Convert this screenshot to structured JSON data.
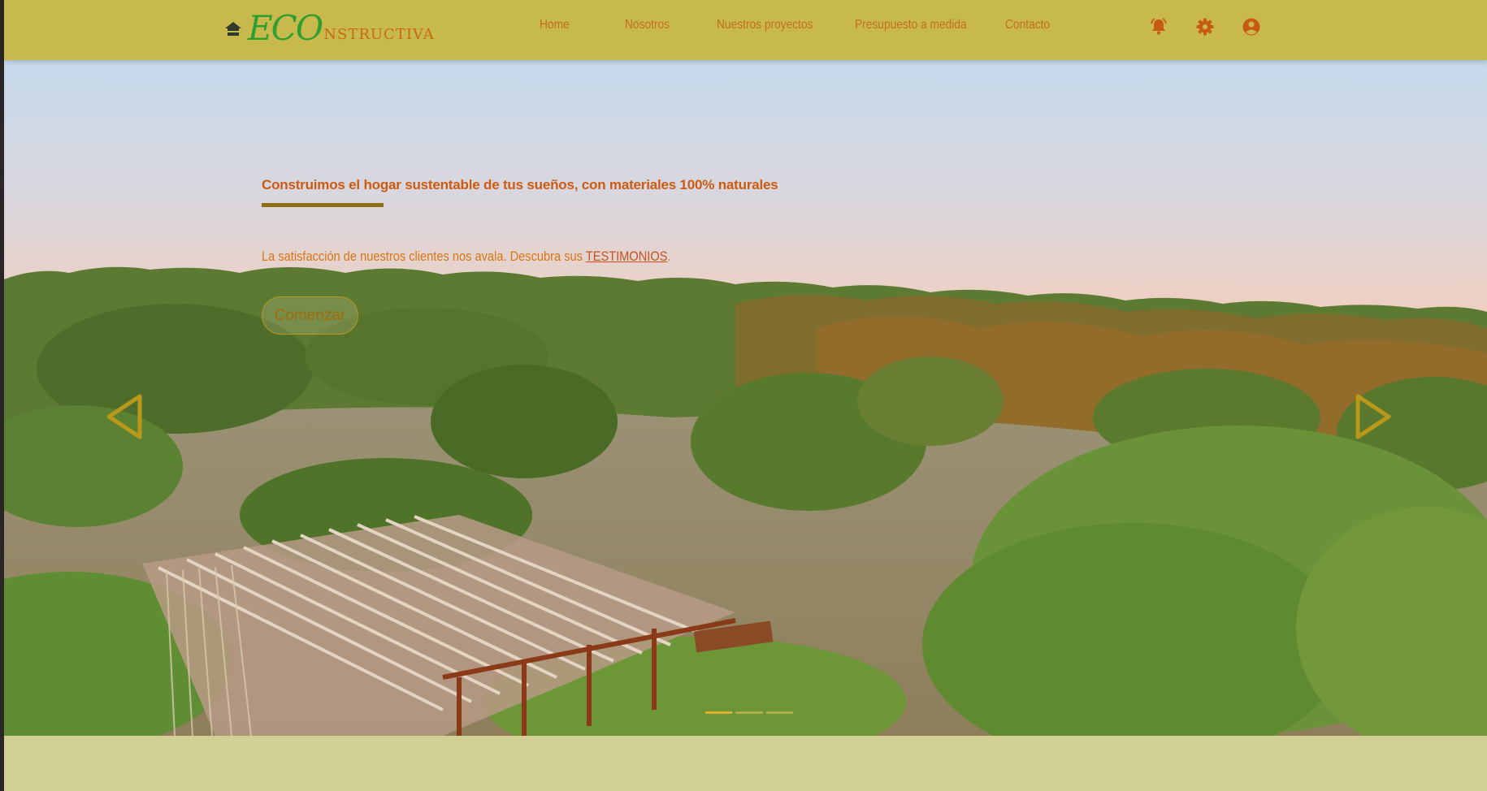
{
  "brand": {
    "prefix": "ECO",
    "suffix": "nstructiva",
    "home_icon": "home-icon",
    "colors": {
      "prefix": "#2e9e30",
      "suffix": "#c86a10"
    }
  },
  "nav": {
    "links": [
      "Home",
      "Nosotros",
      "Nuestros proyectos",
      "Presupuesto a medida",
      "Contacto"
    ],
    "icons": [
      "bell-icon",
      "gear-icon",
      "user-circle-icon"
    ],
    "color": "#c46d1d",
    "background": "#c8b94c"
  },
  "hero": {
    "title": "Construimos el hogar sustentable de tus sueños, con materiales 100% naturales",
    "subtitle_before": "La satisfacción de nuestros clientes nos avala. Descubra sus ",
    "subtitle_link": "TESTIMONIOS",
    "subtitle_after": ".",
    "cta_label": "Comenzar",
    "prev_icon": "triangle-left-icon",
    "next_icon": "triangle-right-icon",
    "accent": "#cc5b12",
    "slide_count": 3,
    "active_slide": 1
  },
  "page": {
    "background": "#d1cf93"
  }
}
